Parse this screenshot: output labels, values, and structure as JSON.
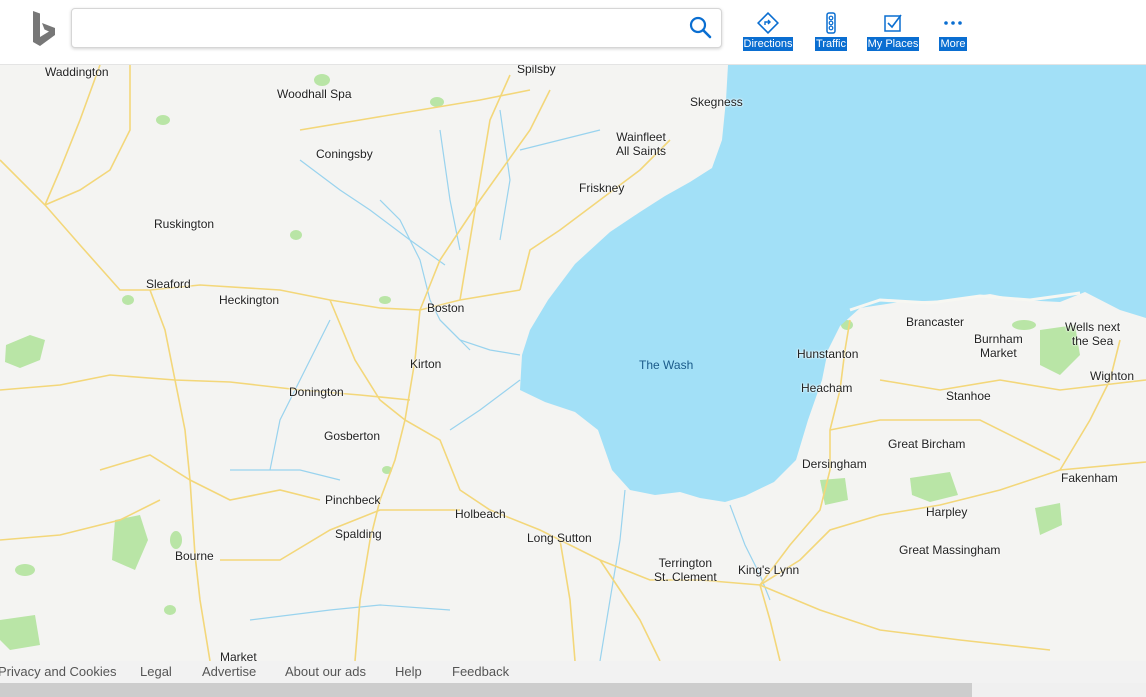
{
  "search": {
    "placeholder": "",
    "value": ""
  },
  "nav": {
    "directions": "Directions",
    "traffic": "Traffic",
    "my_places": "My Places",
    "more": "More"
  },
  "map": {
    "water_label": "The Wash",
    "places": {
      "waddington": "Waddington",
      "spilsby": "Spilsby",
      "woodhall_spa": "Woodhall Spa",
      "skegness": "Skegness",
      "coningsby": "Coningsby",
      "wainfleet_1": "Wainfleet",
      "wainfleet_2": "All Saints",
      "friskney": "Friskney",
      "ruskington": "Ruskington",
      "sleaford": "Sleaford",
      "heckington": "Heckington",
      "boston": "Boston",
      "kirton": "Kirton",
      "donington": "Donington",
      "gosberton": "Gosberton",
      "pinchbeck": "Pinchbeck",
      "spalding": "Spalding",
      "holbeach": "Holbeach",
      "long_sutton": "Long Sutton",
      "terrington_1": "Terrington",
      "terrington_2": "St. Clement",
      "kings_lynn": "King's Lynn",
      "bourne": "Bourne",
      "market": "Market",
      "hunstanton": "Hunstanton",
      "heacham": "Heacham",
      "dersingham": "Dersingham",
      "brancaster": "Brancaster",
      "burnham_1": "Burnham",
      "burnham_2": "Market",
      "wells_1": "Wells next",
      "wells_2": "the Sea",
      "wighton": "Wighton",
      "stanhoe": "Stanhoe",
      "great_bircham": "Great Bircham",
      "fakenham": "Fakenham",
      "harpley": "Harpley",
      "great_massingham": "Great Massingham"
    }
  },
  "footer": {
    "privacy": "Privacy and Cookies",
    "legal": "Legal",
    "advertise": "Advertise",
    "about_ads": "About our ads",
    "help": "Help",
    "feedback": "Feedback"
  }
}
